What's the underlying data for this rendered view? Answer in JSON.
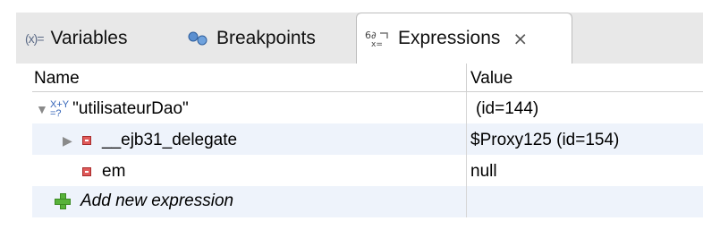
{
  "tabs": [
    {
      "label": "Variables",
      "icon": "variables-icon",
      "active": false
    },
    {
      "label": "Breakpoints",
      "icon": "breakpoints-icon",
      "active": false
    },
    {
      "label": "Expressions",
      "icon": "expressions-icon",
      "active": true,
      "close_symbol": "⨯"
    }
  ],
  "table": {
    "columns": [
      "Name",
      "Value"
    ],
    "rows": [
      {
        "name": "\"utilisateurDao\"",
        "value": "(id=144)",
        "expanded": true,
        "icon": "watch-expression-icon"
      },
      {
        "name": "__ejb31_delegate",
        "value": "$Proxy125  (id=154)",
        "expanded": false,
        "icon": "private-field-icon"
      },
      {
        "name": "em",
        "value": "null",
        "icon": "private-field-icon"
      },
      {
        "name": "Add new expression",
        "value": "",
        "icon": "add-icon"
      }
    ]
  },
  "colors": {
    "tabbar_bg": "#e8e8e8",
    "alt_row": "#eef3fb",
    "field_icon": "#e05a5a",
    "add_icon": "#58b23a"
  }
}
